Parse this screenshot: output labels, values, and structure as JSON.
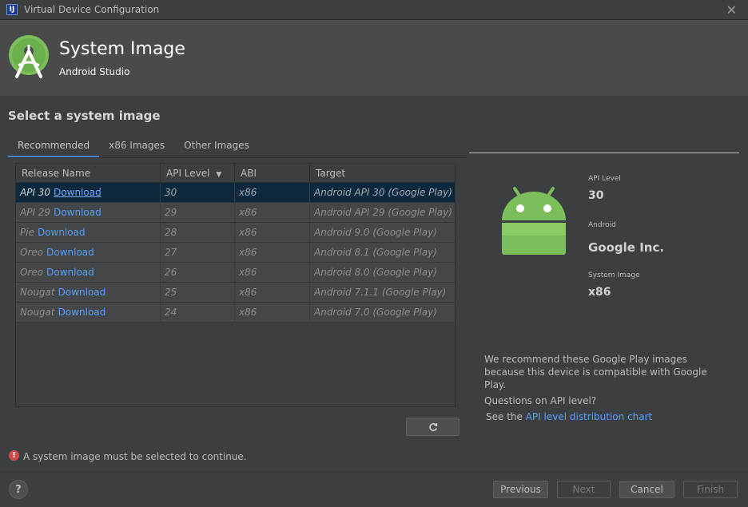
{
  "window": {
    "title": "Virtual Device Configuration",
    "app_icon_glyph": "IJ"
  },
  "header": {
    "title": "System Image",
    "subtitle": "Android Studio"
  },
  "section_heading": "Select a system image",
  "tabs": [
    {
      "label": "Recommended",
      "active": true
    },
    {
      "label": "x86 Images",
      "active": false
    },
    {
      "label": "Other Images",
      "active": false
    }
  ],
  "table": {
    "columns": [
      "Release Name",
      "API Level",
      "ABI",
      "Target"
    ],
    "sort_indicator": "▼",
    "rows": [
      {
        "name": "API 30",
        "download": "Download",
        "api": "30",
        "abi": "x86",
        "target": "Android API 30 (Google Play)"
      },
      {
        "name": "API 29",
        "download": "Download",
        "api": "29",
        "abi": "x86",
        "target": "Android API 29 (Google Play)"
      },
      {
        "name": "Pie",
        "download": "Download",
        "api": "28",
        "abi": "x86",
        "target": "Android 9.0 (Google Play)"
      },
      {
        "name": "Oreo",
        "download": "Download",
        "api": "27",
        "abi": "x86",
        "target": "Android 8.1 (Google Play)"
      },
      {
        "name": "Oreo",
        "download": "Download",
        "api": "26",
        "abi": "x86",
        "target": "Android 8.0 (Google Play)"
      },
      {
        "name": "Nougat",
        "download": "Download",
        "api": "25",
        "abi": "x86",
        "target": "Android 7.1.1 (Google Play)"
      },
      {
        "name": "Nougat",
        "download": "Download",
        "api": "24",
        "abi": "x86",
        "target": "Android 7.0 (Google Play)"
      }
    ]
  },
  "details": {
    "api_level_label": "API Level",
    "api_level_value": "30",
    "android_label": "Android",
    "android_value": "Google Inc.",
    "system_image_label": "System Image",
    "system_image_value": "x86",
    "recommend_text": "We recommend these Google Play images because this device is compatible with Google Play.",
    "question_text": "Questions on API level?",
    "see_text": "See the",
    "chart_link": "API level distribution chart"
  },
  "error_message": "A system image must be selected to continue.",
  "buttons": {
    "previous": "Previous",
    "next": "Next",
    "cancel": "Cancel",
    "finish": "Finish",
    "help": "?"
  },
  "icons": {
    "close": "close-icon",
    "logo": "android-studio-logo-icon",
    "android": "android-robot-icon",
    "refresh": "refresh-icon",
    "error": "error-icon"
  },
  "colors": {
    "background": "#3c3f41",
    "header": "#4a4a4a",
    "selection": "#0d293e",
    "link": "#589df6",
    "android_green": "#7cbf5a",
    "error": "#d24a4a"
  }
}
